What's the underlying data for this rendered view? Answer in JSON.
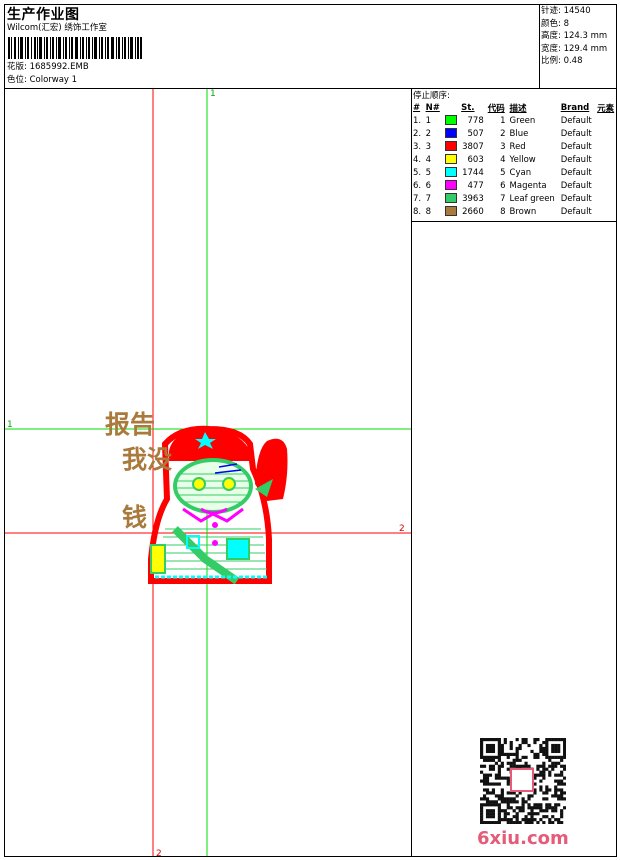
{
  "header": {
    "title": "生产作业图",
    "company": "Wilcom(汇宏) 绣饰工作室",
    "design_label": "花版:",
    "design_value": "1685992.EMB",
    "colorway_label": "色位:",
    "colorway_value": "Colorway 1"
  },
  "stats": {
    "stitches": "针迹:  14540",
    "colors": "颜色:  8",
    "height": "高度:  124.3 mm",
    "width": "宽度:  129.4 mm",
    "scale": "比例:  0.48"
  },
  "stop_sequence": {
    "title": "停止顺序:",
    "headers": [
      "#",
      "N#",
      "",
      "St.",
      "代码",
      "描述",
      "Brand",
      "元素"
    ],
    "rows": [
      {
        "idx": "1.",
        "n": "1",
        "color": "#00ff00",
        "st": "778",
        "code": "1",
        "desc": "Green",
        "brand": "Default"
      },
      {
        "idx": "2.",
        "n": "2",
        "color": "#0000ff",
        "st": "507",
        "code": "2",
        "desc": "Blue",
        "brand": "Default"
      },
      {
        "idx": "3.",
        "n": "3",
        "color": "#ff0000",
        "st": "3807",
        "code": "3",
        "desc": "Red",
        "brand": "Default"
      },
      {
        "idx": "4.",
        "n": "4",
        "color": "#ffff00",
        "st": "603",
        "code": "4",
        "desc": "Yellow",
        "brand": "Default"
      },
      {
        "idx": "5.",
        "n": "5",
        "color": "#00ffff",
        "st": "1744",
        "code": "5",
        "desc": "Cyan",
        "brand": "Default"
      },
      {
        "idx": "6.",
        "n": "6",
        "color": "#ff00ff",
        "st": "477",
        "code": "6",
        "desc": "Magenta",
        "brand": "Default"
      },
      {
        "idx": "7.",
        "n": "7",
        "color": "#33cc66",
        "st": "3963",
        "code": "7",
        "desc": "Leaf green",
        "brand": "Default"
      },
      {
        "idx": "8.",
        "n": "8",
        "color": "#a97a3c",
        "st": "2660",
        "code": "8",
        "desc": "Brown",
        "brand": "Default"
      }
    ]
  },
  "canvas": {
    "axis_labels": [
      "1",
      "1",
      "2",
      "2"
    ],
    "design_text": [
      "报告",
      "我没",
      "钱"
    ]
  },
  "watermark": "6xiu.com"
}
